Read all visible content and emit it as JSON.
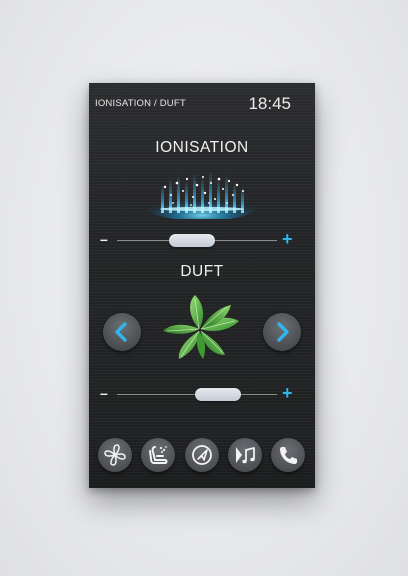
{
  "header": {
    "title": "IONISATION / DUFT",
    "time": "18:45"
  },
  "ionisation": {
    "title": "IONISATION",
    "level": 0.46,
    "minus_label": "–",
    "plus_label": "+"
  },
  "duft": {
    "title": "DUFT",
    "level": 0.68,
    "minus_label": "–",
    "plus_label": "+",
    "scent_icon": "mint-leaves-icon"
  },
  "nav": {
    "items": [
      {
        "name": "fan",
        "icon": "fan-icon"
      },
      {
        "name": "seat-massage",
        "icon": "seat-icon"
      },
      {
        "name": "navigation",
        "icon": "navigation-icon"
      },
      {
        "name": "media",
        "icon": "music-icon"
      },
      {
        "name": "phone",
        "icon": "phone-icon"
      }
    ]
  },
  "colors": {
    "accent": "#2fb6ea",
    "background": "#232425",
    "text": "#f0f0f0"
  }
}
